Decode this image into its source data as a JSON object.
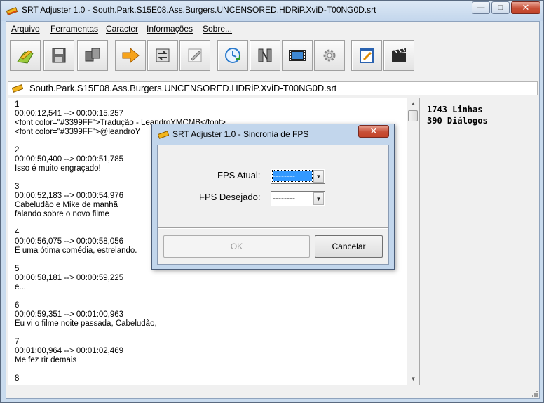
{
  "window": {
    "title": "SRT Adjuster 1.0 - South.Park.S15E08.Ass.Burgers.UNCENSORED.HDRiP.XviD-T00NG0D.srt",
    "minimize_glyph": "—",
    "maximize_glyph": "□",
    "close_glyph": "✕"
  },
  "menu": {
    "items": [
      {
        "label": "Arquivo"
      },
      {
        "label": "Ferramentas"
      },
      {
        "label": "Caracter"
      },
      {
        "label": "Informações"
      },
      {
        "label": "Sobre..."
      }
    ]
  },
  "toolbar": {
    "buttons": [
      {
        "icon": "open-folder-icon"
      },
      {
        "icon": "save-icon"
      },
      {
        "icon": "copy-files-icon"
      },
      {
        "icon": "forward-arrow-icon"
      },
      {
        "icon": "sync-icon"
      },
      {
        "icon": "edit-icon"
      },
      {
        "icon": "clock-icon"
      },
      {
        "icon": "compare-icon"
      },
      {
        "icon": "film-icon"
      },
      {
        "icon": "settings-icon"
      },
      {
        "icon": "notepad-icon"
      },
      {
        "icon": "clapperboard-icon"
      }
    ]
  },
  "file_path": "South.Park.S15E08.Ass.Burgers.UNCENSORED.HDRiP.XviD-T00NG0D.srt",
  "editor": {
    "lines": [
      "1",
      "00:00:12,541 --> 00:00:15,257",
      "<font color=\"#3399FF\">Tradução - LeandroYMCMB</font>",
      "<font color=\"#3399FF\">@leandroY",
      "",
      "2",
      "00:00:50,400 --> 00:00:51,785",
      "Isso é muito engraçado!",
      "",
      "3",
      "00:00:52,183 --> 00:00:54,976",
      "Cabeludão e Mike de manhã",
      "falando sobre o novo filme",
      "",
      "4",
      "00:00:56,075 --> 00:00:58,056",
      "É uma ótima comédia, estrelando.",
      "",
      "5",
      "00:00:58,181 --> 00:00:59,225",
      "e...",
      "",
      "6",
      "00:00:59,351 --> 00:01:00,963",
      "Eu vi o filme noite passada, Cabeludão,",
      "",
      "7",
      "00:01:00,964 --> 00:01:02,469",
      "Me fez rir demais",
      "",
      "8"
    ]
  },
  "stats": {
    "lines": "1743 Linhas",
    "dialogs": "390 Diálogos"
  },
  "dialog": {
    "title": "SRT Adjuster 1.0 - Sincronia de FPS",
    "close_glyph": "✕",
    "fps_atual_label": "FPS Atual:",
    "fps_atual_value": "--------",
    "fps_desejado_label": "FPS Desejado:",
    "fps_desejado_value": "--------",
    "ok_label": "OK",
    "cancel_label": "Cancelar"
  },
  "colors": {
    "accent": "#3399ff",
    "window_frame": "#c9dbee"
  }
}
